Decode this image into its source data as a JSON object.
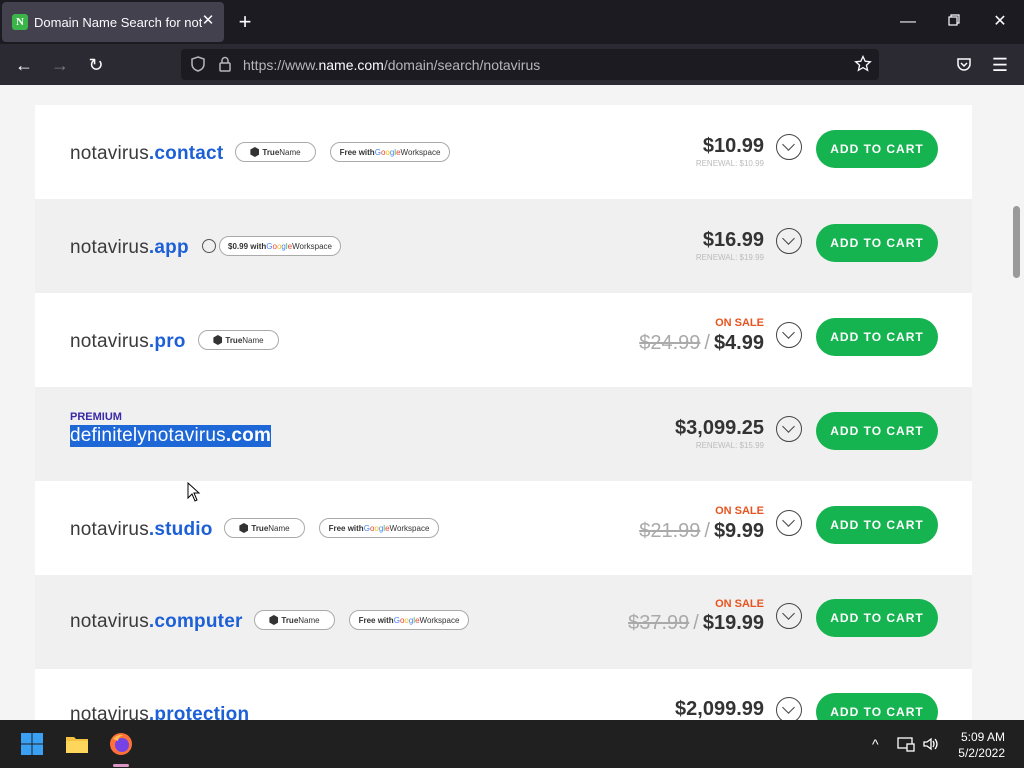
{
  "browser": {
    "tab_favicon": "N",
    "tab_title": "Domain Name Search for notav",
    "url_prefix": "https://www.",
    "url_domain": "name.com",
    "url_path": "/domain/search/notavirus"
  },
  "colors": {
    "brand_green": "#16b451",
    "tld_blue": "#1d5fd6",
    "sale_orange": "#e7541f",
    "premium_purple": "#3a2aa6"
  },
  "rows": [
    {
      "name": "notavirus",
      "tld": ".contact",
      "badges": [
        "TrueName",
        "Free with Google Workspace"
      ],
      "price": "$10.99",
      "renewal": "RENEWAL: $10.99",
      "cart_label": "ADD TO CART"
    },
    {
      "name": "notavirus",
      "tld": ".app",
      "badges": [
        "$0.99 with Google Workspace"
      ],
      "price": "$16.99",
      "renewal": "RENEWAL: $19.99",
      "cart_label": "ADD TO CART"
    },
    {
      "name": "notavirus",
      "tld": ".pro",
      "badges": [
        "TrueName"
      ],
      "on_sale": "ON SALE",
      "old_price": "$24.99",
      "price": "$4.99",
      "cart_label": "ADD TO CART"
    },
    {
      "premium": "PREMIUM",
      "name": "definitelynotavirus",
      "tld": ".com",
      "price": "$3,099.25",
      "renewal": "RENEWAL: $15.99",
      "cart_label": "ADD TO CART"
    },
    {
      "name": "notavirus",
      "tld": ".studio",
      "badges": [
        "TrueName",
        "Free with Google Workspace"
      ],
      "on_sale": "ON SALE",
      "old_price": "$21.99",
      "price": "$9.99",
      "cart_label": "ADD TO CART"
    },
    {
      "name": "notavirus",
      "tld": ".computer",
      "badges": [
        "TrueName",
        "Free with Google Workspace"
      ],
      "on_sale": "ON SALE",
      "old_price": "$37.99",
      "price": "$19.99",
      "cart_label": "ADD TO CART"
    },
    {
      "name": "notavirus",
      "tld": ".protection",
      "price": "$2,099.99",
      "cart_label": "ADD TO CART"
    }
  ],
  "badge_text": {
    "truename_a": "True",
    "truename_b": "Name",
    "free_with": "Free with ",
    "workspace": " Workspace",
    "app_offer": "$0.99 with "
  },
  "taskbar": {
    "time": "5:09 AM",
    "date": "5/2/2022"
  }
}
